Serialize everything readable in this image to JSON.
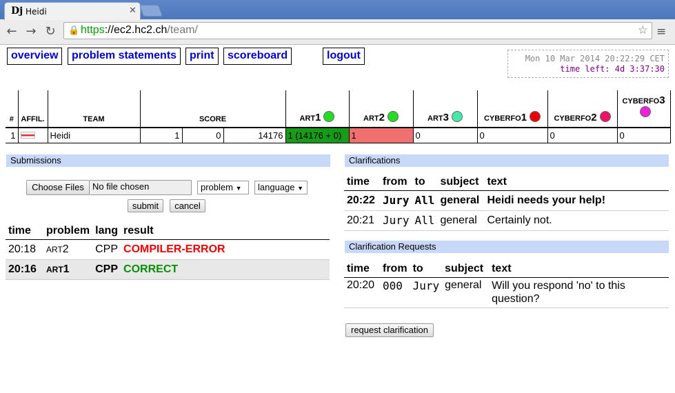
{
  "browser": {
    "tab_title": "Heidi",
    "tab_icon": "Dj",
    "url_scheme": "https",
    "url_host": "://ec2.hc2.ch",
    "url_path": "/team/"
  },
  "nav": {
    "overview": "overview",
    "problems": "problem statements",
    "print": "print",
    "scoreboard": "scoreboard",
    "logout": "logout"
  },
  "clock": {
    "time": "Mon 10 Mar 2014 20:22:29 CET",
    "left": "time left: 4d 3:37:30"
  },
  "scoreboard": {
    "headers": {
      "rank": "#",
      "affil": "AFFIL.",
      "team": "TEAM",
      "score": "SCORE"
    },
    "problems": [
      {
        "name": "ART",
        "num": "1",
        "color": "#22dd22"
      },
      {
        "name": "ART",
        "num": "2",
        "color": "#22dd22"
      },
      {
        "name": "ART",
        "num": "3",
        "color": "#44e8a8"
      },
      {
        "name": "CYBERFO",
        "num": "1",
        "color": "#ee0000"
      },
      {
        "name": "CYBERFO",
        "num": "2",
        "color": "#ee1166"
      },
      {
        "name": "CYBERFO",
        "num": "3",
        "color": "#ee22dd"
      }
    ],
    "row": {
      "rank": "1",
      "team": "Heidi",
      "solved": "1",
      "points": "0",
      "time": "14176",
      "cells": [
        "1 (14176 + 0)",
        "1",
        "0",
        "0",
        "0",
        "0"
      ],
      "cell_colors": [
        "#1a9a1a",
        "#f07070",
        "",
        "",
        "",
        ""
      ]
    }
  },
  "submissions": {
    "title": "Submissions",
    "choose": "Choose Files",
    "nofile": "No file chosen",
    "problem": "problem",
    "language": "language",
    "submit": "submit",
    "cancel": "cancel",
    "headers": [
      "time",
      "problem",
      "lang",
      "result"
    ],
    "rows": [
      {
        "time": "20:18",
        "prob": "ART",
        "num": "2",
        "lang": "CPP",
        "result": "COMPILER-ERROR"
      },
      {
        "time": "20:16",
        "prob": "ART",
        "num": "1",
        "lang": "CPP",
        "result": "CORRECT"
      }
    ]
  },
  "clarifications": {
    "title": "Clarifications",
    "headers": [
      "time",
      "from",
      "to",
      "subject",
      "text"
    ],
    "rows": [
      {
        "time": "20:22",
        "from": "Jury",
        "to": "All",
        "subject": "general",
        "text": "Heidi needs your help!"
      },
      {
        "time": "20:21",
        "from": "Jury",
        "to": "All",
        "subject": "general",
        "text": "Certainly not."
      }
    ]
  },
  "requests": {
    "title": "Clarification Requests",
    "headers": [
      "time",
      "from",
      "to",
      "subject",
      "text"
    ],
    "rows": [
      {
        "time": "20:20",
        "from": "000",
        "to": "Jury",
        "subject": "general",
        "text": "Will you respond 'no' to this question?"
      }
    ],
    "button": "request clarification"
  }
}
